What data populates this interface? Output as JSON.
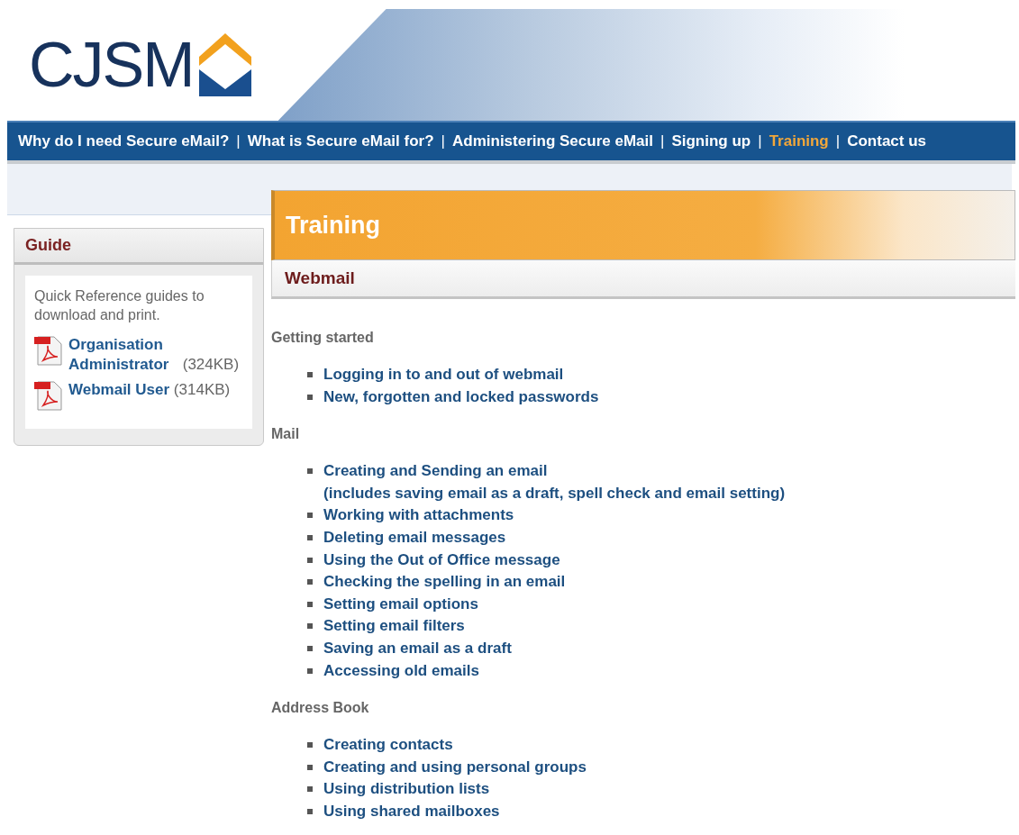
{
  "logo": {
    "text": "CJSM"
  },
  "nav": [
    {
      "label": "Why do I need Secure eMail?",
      "selected": false
    },
    {
      "label": "What is Secure eMail for?",
      "selected": false
    },
    {
      "label": "Administering Secure eMail",
      "selected": false
    },
    {
      "label": "Signing up",
      "selected": false
    },
    {
      "label": "Training",
      "selected": true
    },
    {
      "label": "Contact us",
      "selected": false
    }
  ],
  "nav_separator": "|",
  "sidebar": {
    "title": "Guide",
    "intro": "Quick Reference guides to download and print.",
    "downloads": [
      {
        "label": "Organisation Administrator",
        "size": "(324KB)"
      },
      {
        "label": "Webmail User",
        "size": "(314KB)"
      }
    ]
  },
  "page_title": "Training",
  "section_title": "Webmail",
  "groups": [
    {
      "heading": "Getting started",
      "items": [
        {
          "label": "Logging in to and out of webmail"
        },
        {
          "label": "New, forgotten and locked passwords"
        }
      ]
    },
    {
      "heading": "Mail",
      "items": [
        {
          "label": "Creating and Sending an email",
          "note": "(includes saving email as a draft, spell check and email setting)"
        },
        {
          "label": "Working with attachments"
        },
        {
          "label": "Deleting email messages"
        },
        {
          "label": "Using the Out of Office message"
        },
        {
          "label": "Checking the spelling in an email"
        },
        {
          "label": "Setting email options"
        },
        {
          "label": "Setting email filters"
        },
        {
          "label": "Saving an email as a draft"
        },
        {
          "label": "Accessing old emails"
        }
      ]
    },
    {
      "heading": "Address Book",
      "items": [
        {
          "label": "Creating contacts"
        },
        {
          "label": "Creating and using personal groups"
        },
        {
          "label": "Using distribution lists"
        },
        {
          "label": "Using shared mailboxes"
        }
      ]
    }
  ]
}
